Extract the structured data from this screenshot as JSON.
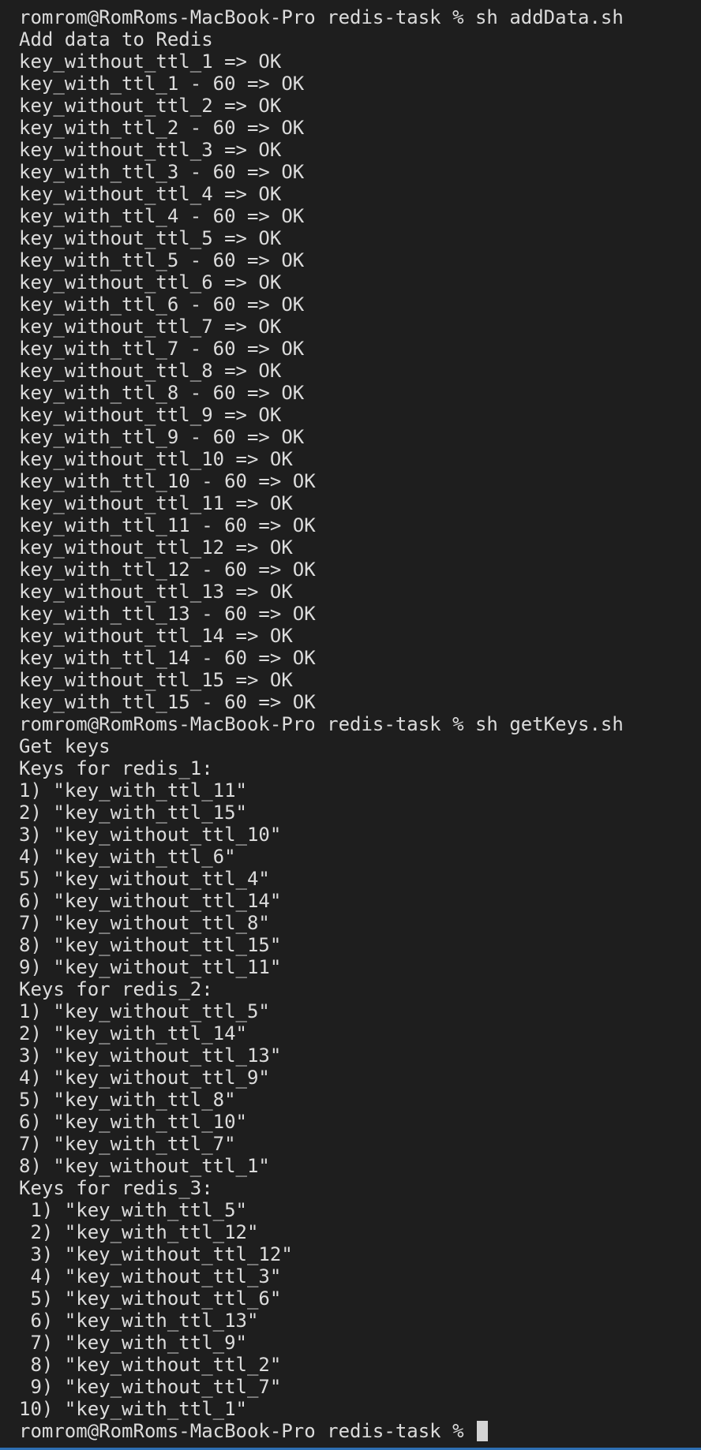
{
  "terminal": {
    "lines": [
      "romrom@RomRoms-MacBook-Pro redis-task % sh addData.sh",
      "Add data to Redis",
      "key_without_ttl_1 => OK",
      "key_with_ttl_1 - 60 => OK",
      "key_without_ttl_2 => OK",
      "key_with_ttl_2 - 60 => OK",
      "key_without_ttl_3 => OK",
      "key_with_ttl_3 - 60 => OK",
      "key_without_ttl_4 => OK",
      "key_with_ttl_4 - 60 => OK",
      "key_without_ttl_5 => OK",
      "key_with_ttl_5 - 60 => OK",
      "key_without_ttl_6 => OK",
      "key_with_ttl_6 - 60 => OK",
      "key_without_ttl_7 => OK",
      "key_with_ttl_7 - 60 => OK",
      "key_without_ttl_8 => OK",
      "key_with_ttl_8 - 60 => OK",
      "key_without_ttl_9 => OK",
      "key_with_ttl_9 - 60 => OK",
      "key_without_ttl_10 => OK",
      "key_with_ttl_10 - 60 => OK",
      "key_without_ttl_11 => OK",
      "key_with_ttl_11 - 60 => OK",
      "key_without_ttl_12 => OK",
      "key_with_ttl_12 - 60 => OK",
      "key_without_ttl_13 => OK",
      "key_with_ttl_13 - 60 => OK",
      "key_without_ttl_14 => OK",
      "key_with_ttl_14 - 60 => OK",
      "key_without_ttl_15 => OK",
      "key_with_ttl_15 - 60 => OK",
      "romrom@RomRoms-MacBook-Pro redis-task % sh getKeys.sh",
      "Get keys",
      "Keys for redis_1:",
      "1) \"key_with_ttl_11\"",
      "2) \"key_with_ttl_15\"",
      "3) \"key_without_ttl_10\"",
      "4) \"key_with_ttl_6\"",
      "5) \"key_without_ttl_4\"",
      "6) \"key_without_ttl_14\"",
      "7) \"key_without_ttl_8\"",
      "8) \"key_without_ttl_15\"",
      "9) \"key_without_ttl_11\"",
      "Keys for redis_2:",
      "1) \"key_without_ttl_5\"",
      "2) \"key_with_ttl_14\"",
      "3) \"key_without_ttl_13\"",
      "4) \"key_without_ttl_9\"",
      "5) \"key_with_ttl_8\"",
      "6) \"key_with_ttl_10\"",
      "7) \"key_with_ttl_7\"",
      "8) \"key_without_ttl_1\"",
      "Keys for redis_3:",
      " 1) \"key_with_ttl_5\"",
      " 2) \"key_with_ttl_12\"",
      " 3) \"key_without_ttl_12\"",
      " 4) \"key_without_ttl_3\"",
      " 5) \"key_without_ttl_6\"",
      " 6) \"key_with_ttl_13\"",
      " 7) \"key_with_ttl_9\"",
      " 8) \"key_without_ttl_2\"",
      " 9) \"key_without_ttl_7\"",
      "10) \"key_with_ttl_1\""
    ],
    "prompt": "romrom@RomRoms-MacBook-Pro redis-task % "
  },
  "colors": {
    "background": "#1e1e1e",
    "text": "#dcdcdc",
    "cursor": "#d4d4d4",
    "bottom_bar": "#2d6fb3"
  }
}
